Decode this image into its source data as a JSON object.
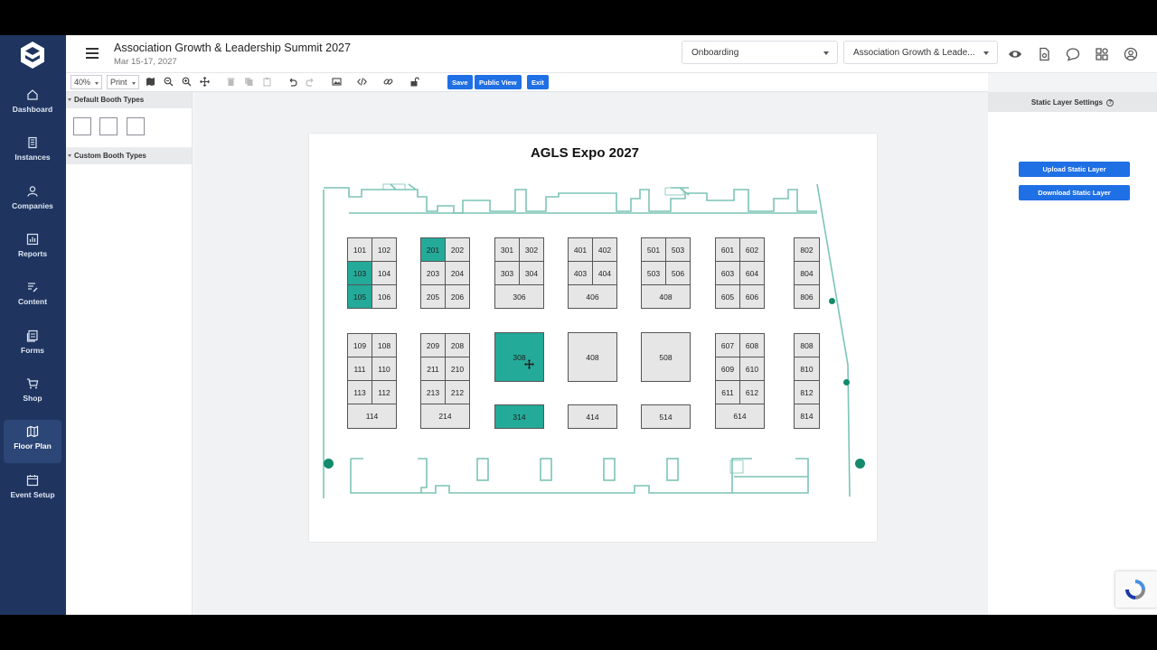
{
  "header": {
    "event_title": "Association Growth & Leadership Summit 2027",
    "event_date": "Mar 15-17, 2027",
    "stage_select": "Onboarding",
    "event_select": "Association Growth & Leade..."
  },
  "sidebar": {
    "items": [
      {
        "label": "Dashboard",
        "icon": "home-icon"
      },
      {
        "label": "Instances",
        "icon": "building-icon"
      },
      {
        "label": "Companies",
        "icon": "people-icon"
      },
      {
        "label": "Reports",
        "icon": "chart-icon"
      },
      {
        "label": "Content",
        "icon": "content-icon"
      },
      {
        "label": "Forms",
        "icon": "forms-icon"
      },
      {
        "label": "Shop",
        "icon": "cart-icon"
      },
      {
        "label": "Floor Plan",
        "icon": "map-icon",
        "active": true
      },
      {
        "label": "Event Setup",
        "icon": "calendar-icon"
      }
    ]
  },
  "toolbar": {
    "zoom": "40%",
    "print": "Print",
    "save": "Save",
    "public_view": "Public View",
    "exit": "Exit"
  },
  "left_panel": {
    "default_booth_types": "Default Booth Types",
    "custom_booth_types": "Custom Booth Types"
  },
  "floor_plan": {
    "title": "AGLS Expo 2027",
    "booths": [
      {
        "label": "101",
        "selected": false
      },
      {
        "label": "102",
        "selected": false
      },
      {
        "label": "103",
        "selected": true
      },
      {
        "label": "104",
        "selected": false
      },
      {
        "label": "105",
        "selected": true
      },
      {
        "label": "106",
        "selected": false
      },
      {
        "label": "201",
        "selected": true
      },
      {
        "label": "202",
        "selected": false
      },
      {
        "label": "203",
        "selected": false
      },
      {
        "label": "204",
        "selected": false
      },
      {
        "label": "205",
        "selected": false
      },
      {
        "label": "206",
        "selected": false
      },
      {
        "label": "301",
        "selected": false
      },
      {
        "label": "302",
        "selected": false
      },
      {
        "label": "303",
        "selected": false
      },
      {
        "label": "304",
        "selected": false
      },
      {
        "label": "306",
        "selected": false
      },
      {
        "label": "401",
        "selected": false
      },
      {
        "label": "402",
        "selected": false
      },
      {
        "label": "403",
        "selected": false
      },
      {
        "label": "404",
        "selected": false
      },
      {
        "label": "406",
        "selected": false
      },
      {
        "label": "501",
        "selected": false
      },
      {
        "label": "503",
        "selected": false
      },
      {
        "label": "503",
        "selected": false
      },
      {
        "label": "506",
        "selected": false
      },
      {
        "label": "408",
        "selected": false
      },
      {
        "label": "601",
        "selected": false
      },
      {
        "label": "602",
        "selected": false
      },
      {
        "label": "603",
        "selected": false
      },
      {
        "label": "604",
        "selected": false
      },
      {
        "label": "605",
        "selected": false
      },
      {
        "label": "606",
        "selected": false
      },
      {
        "label": "802",
        "selected": false
      },
      {
        "label": "804",
        "selected": false
      },
      {
        "label": "806",
        "selected": false
      },
      {
        "label": "109",
        "selected": false
      },
      {
        "label": "108",
        "selected": false
      },
      {
        "label": "111",
        "selected": false
      },
      {
        "label": "110",
        "selected": false
      },
      {
        "label": "113",
        "selected": false
      },
      {
        "label": "112",
        "selected": false
      },
      {
        "label": "114",
        "selected": false
      },
      {
        "label": "209",
        "selected": false
      },
      {
        "label": "208",
        "selected": false
      },
      {
        "label": "211",
        "selected": false
      },
      {
        "label": "210",
        "selected": false
      },
      {
        "label": "213",
        "selected": false
      },
      {
        "label": "212",
        "selected": false
      },
      {
        "label": "214",
        "selected": false
      },
      {
        "label": "308",
        "selected": true
      },
      {
        "label": "314",
        "selected": true
      },
      {
        "label": "408",
        "selected": false
      },
      {
        "label": "414",
        "selected": false
      },
      {
        "label": "508",
        "selected": false
      },
      {
        "label": "514",
        "selected": false
      },
      {
        "label": "607",
        "selected": false
      },
      {
        "label": "608",
        "selected": false
      },
      {
        "label": "609",
        "selected": false
      },
      {
        "label": "610",
        "selected": false
      },
      {
        "label": "611",
        "selected": false
      },
      {
        "label": "612",
        "selected": false
      },
      {
        "label": "614",
        "selected": false
      },
      {
        "label": "808",
        "selected": false
      },
      {
        "label": "810",
        "selected": false
      },
      {
        "label": "812",
        "selected": false
      },
      {
        "label": "814",
        "selected": false
      }
    ]
  },
  "right_panel": {
    "title": "Static Layer Settings",
    "upload": "Upload Static Layer",
    "download": "Download Static Layer"
  },
  "colors": {
    "sidebar": "#1f3560",
    "accent_blue": "#1f6fe5",
    "booth_selected": "#24aa99",
    "wall": "#7cc4b6"
  }
}
